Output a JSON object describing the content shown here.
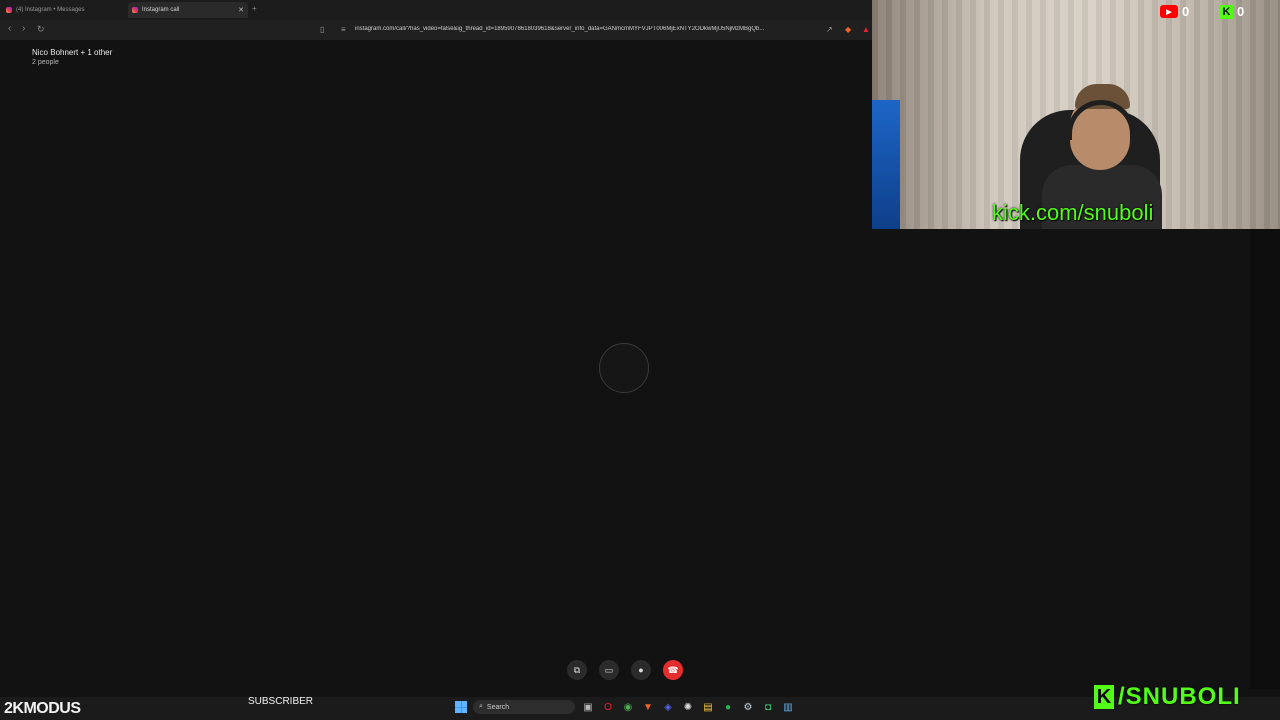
{
  "browser": {
    "tabs": [
      {
        "label": "(4) Instagram • Messages",
        "active": false
      },
      {
        "label": "Instagram call",
        "active": true
      }
    ],
    "url": "instagram.com/call/?has_video=false&ig_thread_id=18959078618039618&server_info_data=GANmcmMYFVJPT006MjExNTY2ODkwMjU5NjMzMBgQb..."
  },
  "call": {
    "title": "Nico Bohnert + 1 other",
    "subtitle": "2 people",
    "controls": [
      "screen-share",
      "video-off",
      "microphone",
      "end-call"
    ]
  },
  "overlay": {
    "kick_url": "kick.com/snuboli",
    "youtube_count": "0",
    "kick_count": "0",
    "brand_left": "2KMODUS",
    "subscriber_label": "SUBSCRIBER",
    "kick_brand": "/SNUBOLI"
  },
  "taskbar": {
    "search_placeholder": "Search",
    "apps": [
      "task-view",
      "opera",
      "chrome",
      "brave",
      "discord",
      "chatgpt",
      "file-explorer",
      "spotify",
      "steam",
      "app-green",
      "notepad"
    ]
  },
  "colors": {
    "background": "#121212",
    "kick_green": "#53fc18",
    "end_call_red": "#e62d2d",
    "youtube_red": "#ff0000"
  }
}
